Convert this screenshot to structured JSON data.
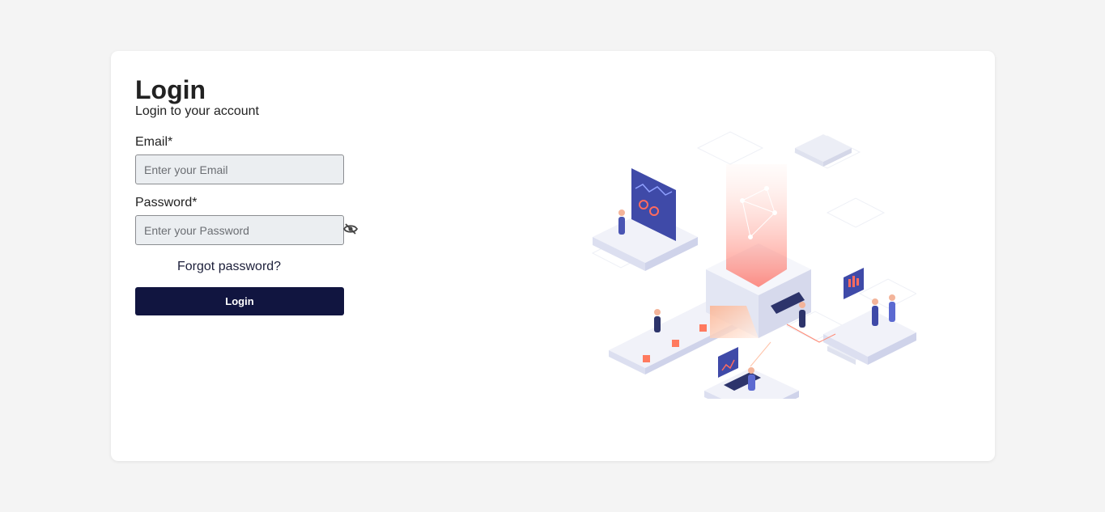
{
  "page": {
    "title": "Login",
    "subtitle": "Login to your account"
  },
  "form": {
    "email_label": "Email*",
    "email_placeholder": "Enter your Email",
    "email_value": "",
    "password_label": "Password*",
    "password_placeholder": "Enter your Password",
    "password_value": "",
    "password_toggle_icon": "eye-slash-icon",
    "forgot_label": "Forgot password?",
    "login_label": "Login"
  },
  "colors": {
    "background": "#f4f4f4",
    "card": "#ffffff",
    "input_bg": "#ebeef1",
    "button_bg": "#111540",
    "accent": "#ff6b5e",
    "illustration_purple": "#3f4aa8"
  }
}
